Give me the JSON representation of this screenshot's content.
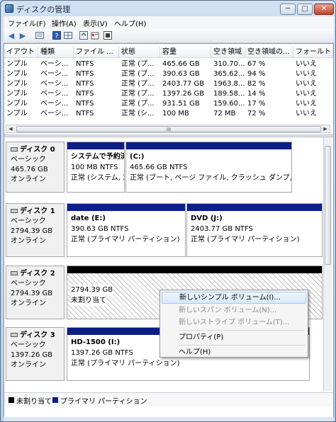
{
  "window": {
    "title": "ディスクの管理",
    "min": "─",
    "max": "□",
    "close": "✕"
  },
  "menu": [
    "ファイル(F)",
    "操作(A)",
    "表示(V)",
    "ヘルプ(H)"
  ],
  "toolbar": {
    "back": "◀",
    "forward": "▶",
    "icons": [
      "list-icon",
      "help-icon",
      "grid-icon",
      "refresh-icon",
      "properties-icon",
      "settings-icon"
    ]
  },
  "volume_list": {
    "headers": [
      "イアウト",
      "種類",
      "ファイル ...",
      "状態",
      "容量",
      "空き領域",
      "空き領域の...",
      "フォールト"
    ],
    "rows": [
      [
        "ンプル",
        "ベーシ...",
        "NTFS",
        "正常 (プ...",
        "465.66 GB",
        "310.70...",
        "67 %",
        "いいえ"
      ],
      [
        "ンプル",
        "ベーシ...",
        "NTFS",
        "正常 (プ...",
        "390.63 GB",
        "365.62...",
        "94 %",
        "いいえ"
      ],
      [
        "ンプル",
        "ベーシ...",
        "NTFS",
        "正常 (プ...",
        "2403.77 GB",
        "1963.8...",
        "82 %",
        "いいえ"
      ],
      [
        "ンプル",
        "ベーシ...",
        "NTFS",
        "正常 (プ...",
        "1397.26 GB",
        "189.58...",
        "14 %",
        "いいえ"
      ],
      [
        "ンプル",
        "ベーシ...",
        "NTFS",
        "正常 (プ...",
        "931.51 GB",
        "159.60...",
        "17 %",
        "いいえ"
      ],
      [
        "ンプル",
        "ベーシ...",
        "NTFS",
        "正常 (シ...",
        "100 MB",
        "72 MB",
        "72 %",
        "いいえ"
      ]
    ],
    "scroll_thumb": "III"
  },
  "disks": [
    {
      "name": "ディスク 0",
      "type": "ベーシック",
      "size": "465.76 GB",
      "status": "オンライン",
      "partitions": [
        {
          "name": "システムで予約済",
          "size": "100 MB NTFS",
          "status": "正常 (システム, ｱ"
        },
        {
          "name": "(C:)",
          "size": "465.66 GB NTFS",
          "status": "正常 (ブート, ページ ファイル, クラッシュ ダンプ, プ"
        }
      ]
    },
    {
      "name": "ディスク 1",
      "type": "ベーシック",
      "size": "2794.39 GB",
      "status": "オンライン",
      "partitions": [
        {
          "name": "date  (E:)",
          "size": "390.63 GB NTFS",
          "status": "正常 (プライマリ パーティション)"
        },
        {
          "name": "DVD  (J:)",
          "size": "2403.77 GB NTFS",
          "status": "正常 (プライマリ パーティション)"
        }
      ]
    },
    {
      "name": "ディスク 2",
      "type": "ベーシック",
      "size": "2794.39 GB",
      "status": "オンライン",
      "partitions": [
        {
          "name": "",
          "size": "2794.39 GB",
          "status": "未割り当て"
        }
      ]
    },
    {
      "name": "ディスク 3",
      "type": "ベーシック",
      "size": "1397.26 GB",
      "status": "オンライン",
      "partitions": [
        {
          "name": "HD-1500  (I:)",
          "size": "1397.26 GB NTFS",
          "status": "正常 (プライマリ パーティション)"
        }
      ]
    }
  ],
  "legend": {
    "unallocated": "未割り当て",
    "primary": "プライマリ パーティション"
  },
  "context_menu": [
    {
      "label": "新しいシンプル ボリューム(I)...",
      "enabled": true
    },
    {
      "label": "新しいスパン ボリューム(N)...",
      "enabled": false
    },
    {
      "label": "新しいストライプ ボリューム(T)...",
      "enabled": false
    },
    {
      "label": "プロパティ(P)",
      "enabled": true
    },
    {
      "label": "ヘルプ(H)",
      "enabled": true
    }
  ],
  "colors": {
    "primary_partition": "#0c1f86",
    "unallocated": "#000000"
  }
}
